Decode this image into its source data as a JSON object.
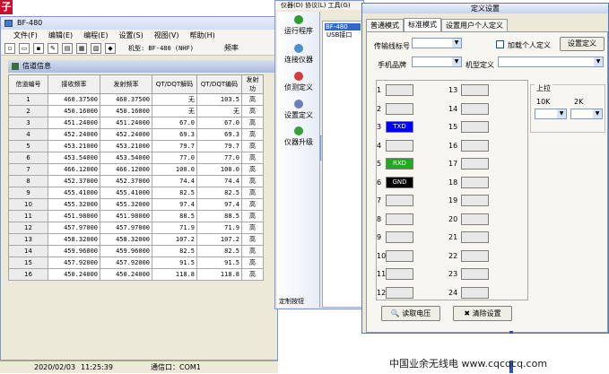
{
  "logo_text": "子",
  "main": {
    "title": "BF-480",
    "menu": [
      "文件(F)",
      "编辑(E)",
      "编程(E)",
      "设置(S)",
      "视图(V)",
      "帮助(H)"
    ],
    "model_label": "机型: BF-480 (NHF)",
    "freq_label": "频率",
    "channel_panel_title": "信道信息",
    "headers": [
      "信道编号",
      "接收频率",
      "发射频率",
      "QT/DQT解码",
      "QT/DQT编码",
      "发射功"
    ],
    "rows": [
      [
        "1",
        "460.37500",
        "460.37500",
        "无",
        "103.5",
        "高"
      ],
      [
        "2",
        "450.16000",
        "450.16000",
        "无",
        "无",
        "高"
      ],
      [
        "3",
        "451.24000",
        "451.24000",
        "67.0",
        "67.0",
        "高"
      ],
      [
        "4",
        "452.24000",
        "452.24000",
        "69.3",
        "69.3",
        "高"
      ],
      [
        "5",
        "453.21000",
        "453.21000",
        "79.7",
        "79.7",
        "高"
      ],
      [
        "6",
        "453.54000",
        "453.54000",
        "77.0",
        "77.0",
        "高"
      ],
      [
        "7",
        "466.12000",
        "466.12000",
        "100.0",
        "100.0",
        "高"
      ],
      [
        "8",
        "452.37000",
        "452.37000",
        "74.4",
        "74.4",
        "高"
      ],
      [
        "9",
        "455.41000",
        "455.41000",
        "82.5",
        "82.5",
        "高"
      ],
      [
        "10",
        "455.32000",
        "455.32000",
        "97.4",
        "97.4",
        "高"
      ],
      [
        "11",
        "451.98000",
        "451.98000",
        "88.5",
        "88.5",
        "高"
      ],
      [
        "12",
        "457.97000",
        "457.97000",
        "71.9",
        "71.9",
        "高"
      ],
      [
        "13",
        "458.32000",
        "458.32000",
        "107.2",
        "107.2",
        "高"
      ],
      [
        "14",
        "459.96000",
        "459.96000",
        "82.5",
        "82.5",
        "高"
      ],
      [
        "15",
        "457.92000",
        "457.92000",
        "91.5",
        "91.5",
        "高"
      ],
      [
        "16",
        "450.24000",
        "450.24000",
        "118.8",
        "118.8",
        "高"
      ]
    ],
    "status": {
      "date": "2020/02/03",
      "time": "11:25:39",
      "comm": "通信口：COM1"
    }
  },
  "middle": {
    "menu": "仪器(D)  协议(L)  工具(G)",
    "side": [
      "运行程序",
      "连接仪器",
      "侦测定义",
      "设置定义",
      "仪器升级"
    ],
    "tree_selected": "BF-480",
    "tree_usb": "USB接口",
    "custom_btn": "定制按钮"
  },
  "dialog": {
    "title": "定义设置",
    "tabs": [
      "普通模式",
      "标准模式",
      "设置用户个人定义"
    ],
    "tx_label": "传输线标号",
    "add_custom": "加载个人定义",
    "set_def_btn": "设置定义",
    "brand_label": "手机品牌",
    "model_label": "机型定义",
    "slots_left": [
      {
        "n": "1",
        "t": ""
      },
      {
        "n": "2",
        "t": ""
      },
      {
        "n": "3",
        "t": "TXD"
      },
      {
        "n": "4",
        "t": ""
      },
      {
        "n": "5",
        "t": "RXD"
      },
      {
        "n": "6",
        "t": "GND"
      },
      {
        "n": "7",
        "t": ""
      },
      {
        "n": "8",
        "t": ""
      },
      {
        "n": "9",
        "t": ""
      },
      {
        "n": "10",
        "t": ""
      },
      {
        "n": "11",
        "t": ""
      },
      {
        "n": "12",
        "t": ""
      }
    ],
    "slots_right": [
      "13",
      "14",
      "15",
      "16",
      "17",
      "18",
      "19",
      "20",
      "21",
      "22",
      "23",
      "24"
    ],
    "pullup_title": "上拉",
    "pullup_10k": "10K",
    "pullup_2k": "2K",
    "read_btn": "读取电压",
    "clear_btn": "清除设置",
    "colors": {
      "txd": "#0000ff",
      "rxd": "#1faa1f",
      "gnd": "#000000"
    }
  },
  "watermark": "中国业余无线电 www.cqcqcq.com"
}
